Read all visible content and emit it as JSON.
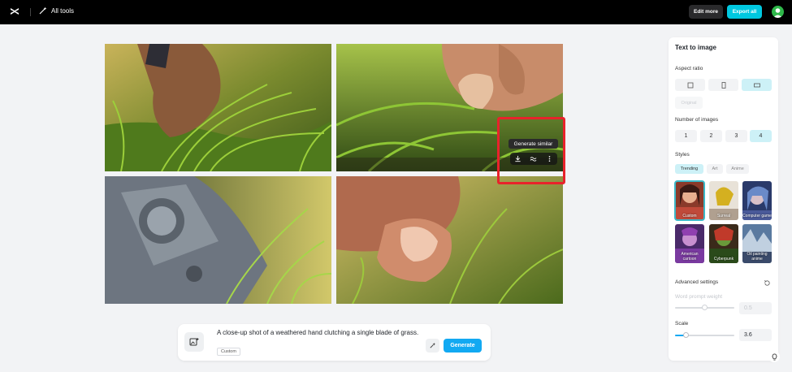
{
  "topbar": {
    "all_tools_label": "All tools",
    "edit_more_label": "Edit more",
    "export_all_label": "Export all"
  },
  "image_overlay": {
    "tooltip": "Generate similar",
    "icons": [
      "download-icon",
      "generate-similar-icon",
      "more-icon"
    ]
  },
  "prompt_bar": {
    "text": "A close-up shot of a weathered hand clutching a single blade of grass.",
    "style_tag": "Custom",
    "generate_label": "Generate"
  },
  "panel": {
    "title": "Text to image",
    "aspect_ratio": {
      "label": "Aspect ratio",
      "options": [
        "square-icon",
        "portrait-icon",
        "landscape-icon"
      ],
      "selected": 2,
      "original_label": "Original"
    },
    "num_images": {
      "label": "Number of images",
      "options": [
        "1",
        "2",
        "3",
        "4"
      ],
      "selected": 3
    },
    "styles": {
      "label": "Styles",
      "tabs": [
        "Trending",
        "Art",
        "Anime"
      ],
      "selected_tab": 0,
      "items": [
        "Custom",
        "Surreal",
        "Computer game",
        "American cartoon",
        "Cyberpunk",
        "Oil painting anime"
      ],
      "selected_item": 0
    },
    "advanced": {
      "label": "Advanced settings",
      "word_prompt_weight_label": "Word prompt weight",
      "word_prompt_weight_value": "0.5",
      "scale_label": "Scale",
      "scale_value": "3.6"
    }
  },
  "colors": {
    "accent": "#00c8e0",
    "generate": "#12a9f2",
    "highlight": "#e8232b",
    "selected_bg": "#cdf1f7"
  }
}
